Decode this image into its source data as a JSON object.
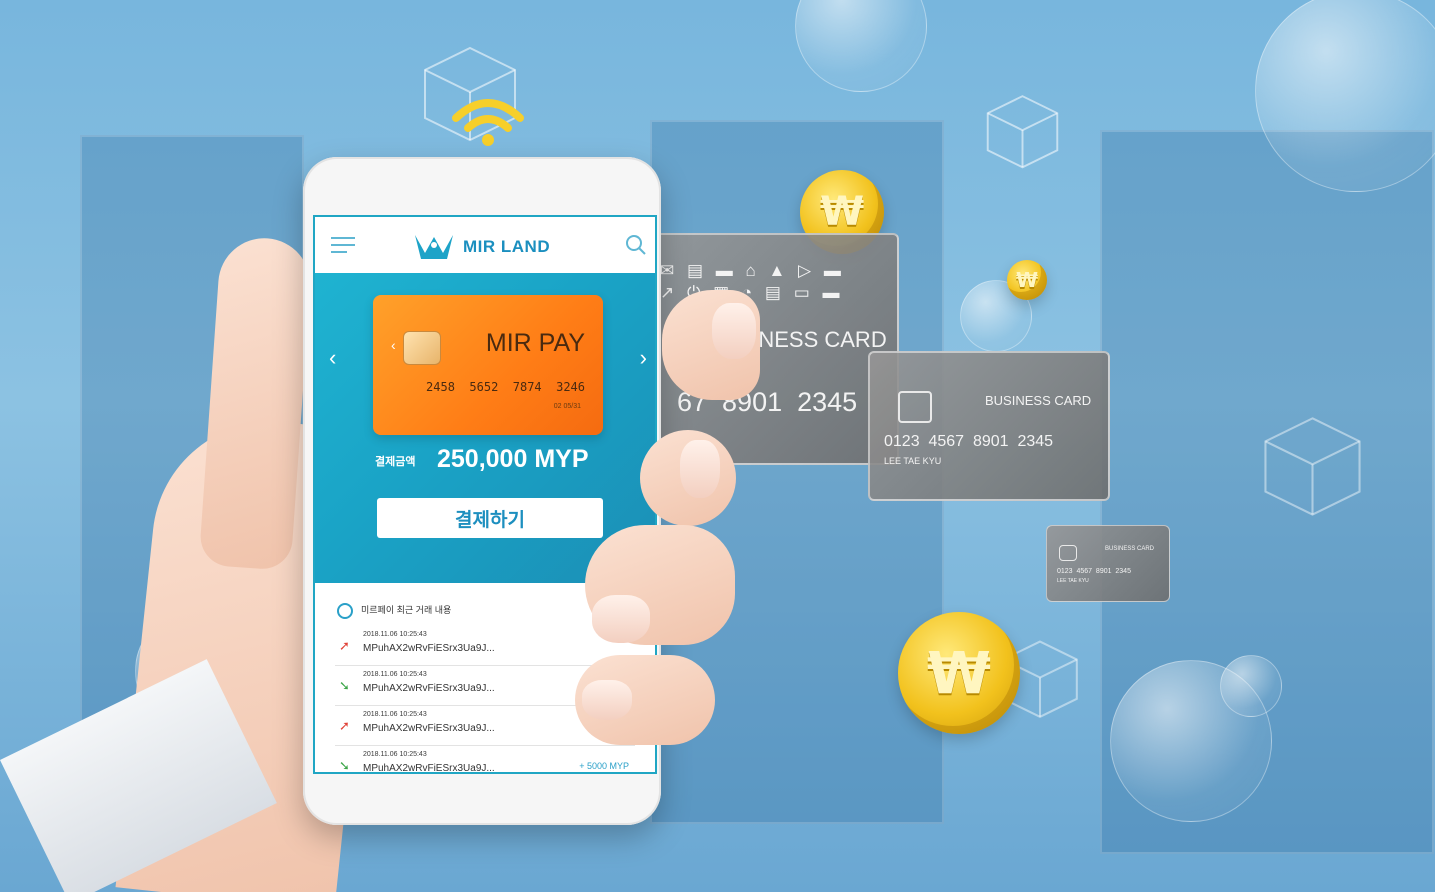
{
  "app": {
    "brand": "MIR LAND",
    "menu_icon": "hamburger-menu-icon",
    "search_icon": "search-icon",
    "logo_icon": "mirland-logo-icon"
  },
  "pay_card": {
    "name": "MIR PAY",
    "number": "2458  5652  7874  3246",
    "expiry": "02  05/31",
    "chip_icon": "card-chip-icon"
  },
  "payment": {
    "amount_label": "결제금액",
    "amount": "250,000 MYP",
    "pay_button": "결제하기"
  },
  "transactions": {
    "title": "미르페이 최근 거래 내용",
    "items": [
      {
        "date": "2018.11.06 10:25:43",
        "hash": "MPuhAX2wRvFiESrx3Ua9J...",
        "amount": "",
        "type": "send"
      },
      {
        "date": "2018.11.06 10:25:43",
        "hash": "MPuhAX2wRvFiESrx3Ua9J...",
        "amount": "",
        "type": "receive"
      },
      {
        "date": "2018.11.06 10:25:43",
        "hash": "MPuhAX2wRvFiESrx3Ua9J...",
        "amount": "",
        "type": "send"
      },
      {
        "date": "2018.11.06 10:25:43",
        "hash": "MPuhAX2wRvFiESrx3Ua9J...",
        "amount": "+ 5000 MYP",
        "type": "receive"
      }
    ]
  },
  "business_cards": [
    {
      "label": "BUSINESS CARD",
      "number": "67  8901  2345"
    },
    {
      "label": "BUSINESS CARD",
      "number": "0123  4567  8901  2345",
      "holder": "LEE TAE KYU"
    },
    {
      "label": "BUSINESS CARD",
      "number": "0123  4567  8901  2345",
      "holder": "LEE TAE KYU"
    }
  ],
  "colors": {
    "accent": "#1aa3c6",
    "card_orange": "#ff8a1c",
    "coin_gold": "#f2c21d",
    "background": "#7fb8da"
  }
}
